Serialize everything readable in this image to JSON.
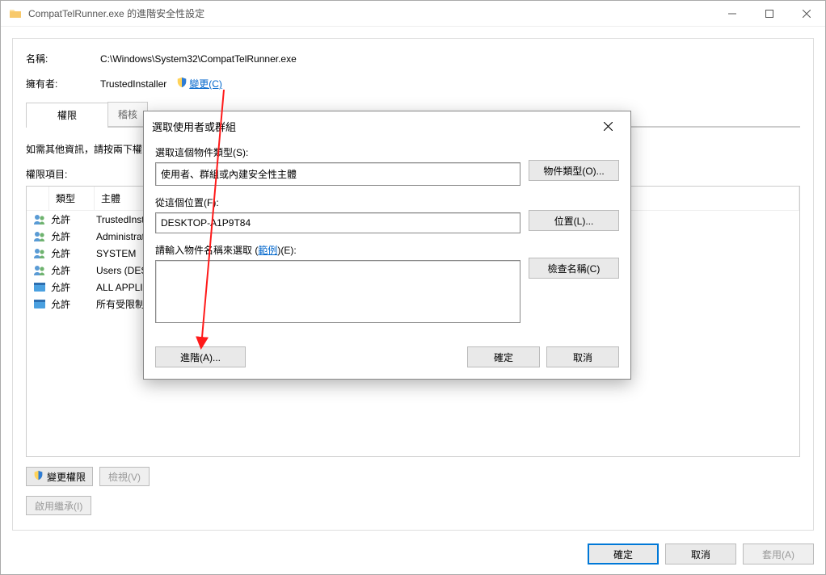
{
  "titlebar": {
    "title": "CompatTelRunner.exe 的進階安全性設定"
  },
  "main": {
    "name_label": "名稱:",
    "name_value": "C:\\Windows\\System32\\CompatTelRunner.exe",
    "owner_label": "擁有者:",
    "owner_value": "TrustedInstaller",
    "change_link": "變更(C)",
    "tabs": {
      "perm": "權限",
      "audit": "稽核"
    },
    "info_line": "如需其他資訊，請按兩下權限項目。",
    "perm_header": "權限項目:",
    "cols": {
      "type": "類型",
      "principal": "主體"
    },
    "allow": "允許",
    "rows": [
      {
        "icon": "group",
        "principal": "TrustedInstaller"
      },
      {
        "icon": "group",
        "principal": "Administrators"
      },
      {
        "icon": "group",
        "principal": "SYSTEM"
      },
      {
        "icon": "group",
        "principal": "Users (DESKTOP-A1P9T84\\Users)"
      },
      {
        "icon": "app",
        "principal": "ALL APPLICATION PACKAGES"
      },
      {
        "icon": "app",
        "principal": "所有受限制的應用程式套件"
      }
    ],
    "change_perm_btn": "變更權限",
    "view_btn": "檢視(V)",
    "inherit_btn": "啟用繼承(I)",
    "ok_btn": "確定",
    "cancel_btn": "取消",
    "apply_btn": "套用(A)"
  },
  "dialog": {
    "title": "選取使用者或群組",
    "obj_type_label": "選取這個物件類型(S):",
    "obj_type_value": "使用者、群組或內建安全性主體",
    "obj_type_btn": "物件類型(O)...",
    "location_label": "從這個位置(F):",
    "location_value": "DESKTOP-A1P9T84",
    "location_btn": "位置(L)...",
    "name_label_pre": "請輸入物件名稱來選取 (",
    "name_label_link": "範例",
    "name_label_post": ")(E):",
    "check_btn": "檢查名稱(C)",
    "advanced_btn": "進階(A)...",
    "ok_btn": "確定",
    "cancel_btn": "取消"
  }
}
